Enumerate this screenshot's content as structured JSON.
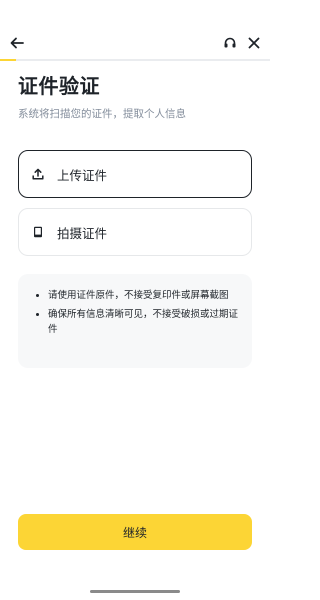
{
  "header": {
    "back_icon": "arrow-left-icon",
    "support_icon": "headset-icon",
    "close_icon": "close-icon",
    "progress": 0.06,
    "accent_color": "#fcd535"
  },
  "main": {
    "title": "证件验证",
    "subtitle": "系统将扫描您的证件，提取个人信息"
  },
  "options": [
    {
      "label": "上传证件",
      "icon": "upload-icon"
    },
    {
      "label": "拍摄证件",
      "icon": "camera-phone-icon"
    }
  ],
  "tips": [
    "请使用证件原件，不接受复印件或屏幕截图",
    "确保所有信息清晰可见，不接受破损或过期证件"
  ],
  "footer": {
    "continue_label": "继续"
  }
}
